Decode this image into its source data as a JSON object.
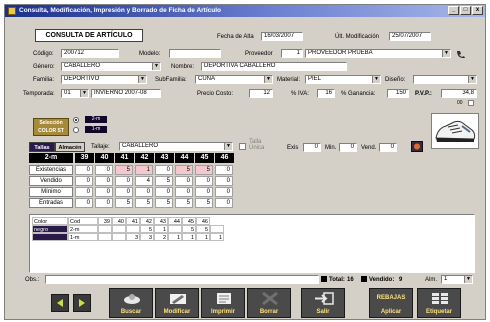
{
  "window": {
    "title": "Consulta, Modificación, Impresión y Borrado de Ficha de Artículo",
    "buttons": [
      "_",
      "□",
      "x"
    ]
  },
  "header": {
    "title": "CONSULTA DE ARTÍCULO"
  },
  "dates": {
    "alta_label": "Fecha de Alta",
    "alta_value": "16/03/2007",
    "ult_label": "Últ. Modificación",
    "ult_value": "25/07/2007"
  },
  "form": {
    "codigo_label": "Código:",
    "codigo": "200712",
    "modelo_label": "Modelo:",
    "modelo": "",
    "proveedor_label": "Proveedor",
    "proveedor_num": "1",
    "proveedor": "PROVEEDOR PRUEBA",
    "genero_label": "Género:",
    "genero": "CABALLERO",
    "nombre_label": "Nombre:",
    "nombre": "DEPORTIVA CABALLERO",
    "familia_label": "Familia:",
    "familia": "DEPORTIVO",
    "subfamilia_label": "SubFamilia:",
    "subfamilia": "CUÑA",
    "material_label": "Material:",
    "material": "PIEL",
    "diseno_label": "Diseño:",
    "diseno": "",
    "temporada_label": "Temporada:",
    "temporada_code": "01",
    "temporada": "INVIERNO 2007-08",
    "precio_label": "Precio Costo:",
    "precio": "12",
    "iva_label": "% IVA:",
    "iva": "16",
    "ganancia_label": "% Ganancia:",
    "ganancia": "150",
    "pvp_label": "P.V.P.:",
    "pvp": "34,8",
    "pvp_sub": "00"
  },
  "colores": {
    "button": "Selección COLOR ST",
    "opt1": "2-m",
    "opt2": "1-m",
    "swatch_color": "#14082a"
  },
  "tabs": {
    "tallas": "Tallas",
    "almacen": "Almacén",
    "tallaje_label": "Tallaje:",
    "tallaje": "CABALLERO",
    "talla_unica": "Talla Única",
    "exis_label": "Exis",
    "exis": "0",
    "min_label": "Min.",
    "min": "0",
    "vend_label": "Vend.",
    "vend": "0"
  },
  "size_grid": {
    "corner": "2-m",
    "sizes": [
      "39",
      "40",
      "41",
      "42",
      "43",
      "44",
      "45",
      "46"
    ],
    "rows": [
      {
        "label": "Existencias",
        "values": [
          "0",
          "0",
          "5",
          "1",
          "0",
          "5",
          "5",
          "0"
        ]
      },
      {
        "label": "Vendido",
        "values": [
          "0",
          "0",
          "0",
          "4",
          "5",
          "0",
          "0",
          "0"
        ]
      },
      {
        "label": "Mínimo",
        "values": [
          "0",
          "0",
          "0",
          "0",
          "0",
          "0",
          "0",
          "0"
        ]
      },
      {
        "label": "Entradas",
        "values": [
          "0",
          "0",
          "5",
          "5",
          "5",
          "5",
          "5",
          "0"
        ]
      }
    ]
  },
  "stock_list": {
    "headers": [
      "Color",
      "Cod",
      "39",
      "40",
      "41",
      "42",
      "43",
      "44",
      "45",
      "46"
    ],
    "rows": [
      {
        "color": "negro",
        "cod": "2-m",
        "values": [
          "",
          "",
          "",
          "5",
          "1",
          "",
          "5",
          "5",
          ""
        ]
      },
      {
        "color": "",
        "cod": "1-m",
        "values": [
          "",
          "",
          "3",
          "3",
          "2",
          "1",
          "1",
          "1",
          "1"
        ]
      }
    ]
  },
  "status": {
    "obs_label": "Obs.:",
    "obs": "",
    "total_label": "Total:",
    "total": "16",
    "vendido_label": "Vendido:",
    "vendido": "9",
    "alm_label": "Alm.",
    "alm": "1"
  },
  "toolbar": {
    "buscar": "Buscar",
    "modificar": "Modificar",
    "imprimir": "Imprimir",
    "borrar": "Borrar",
    "salir": "Salir",
    "aplicar": "Aplicar",
    "rebajas": "REBAJAS",
    "etiquetar": "Etiquetar"
  }
}
